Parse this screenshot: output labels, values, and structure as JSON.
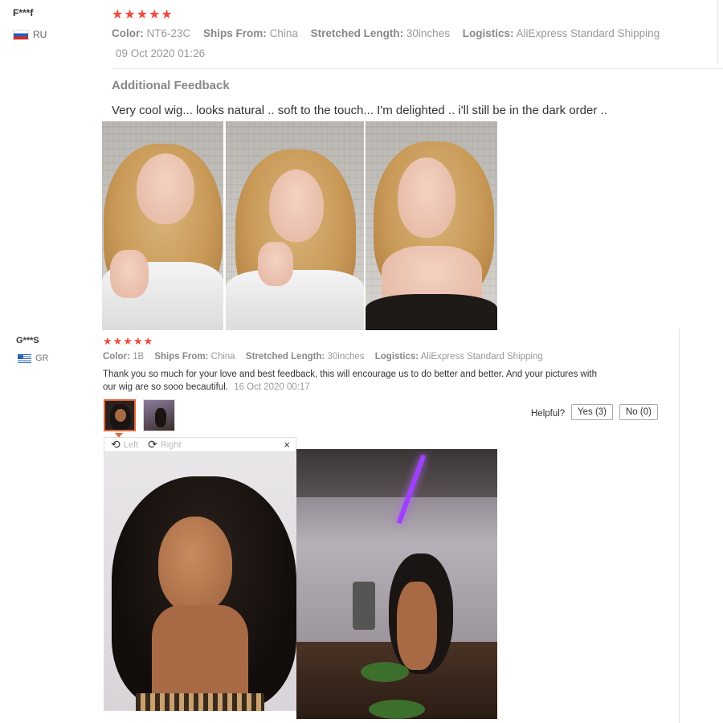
{
  "review1": {
    "user": "F***f",
    "country": "RU",
    "stars": "★★★★★",
    "color_label": "Color:",
    "color_value": "NT6-23C",
    "ships_label": "Ships From:",
    "ships_value": "China",
    "length_label": "Stretched Length:",
    "length_value": "30inches",
    "logistics_label": "Logistics:",
    "logistics_value": "AliExpress Standard Shipping",
    "date": "09 Oct 2020 01:26",
    "additional_title": "Additional Feedback",
    "text": "Very cool wig... looks natural .. soft to the touch... I'm delighted .. i'll still be in the dark order .."
  },
  "review2": {
    "user": "G***S",
    "country": "GR",
    "stars": "★★★★★",
    "color_label": "Color:",
    "color_value": "1B",
    "ships_label": "Ships From:",
    "ships_value": "China",
    "length_label": "Stretched Length:",
    "length_value": "30inches",
    "logistics_label": "Logistics:",
    "logistics_value": "AliExpress Standard Shipping",
    "text": "Thank you so much for your love and best feedback, this will encourage us to do better and better. And your pictures with our wig are so sooo becautiful.",
    "date": "16 Oct 2020 00:17",
    "helpful_label": "Helpful?",
    "yes_label": "Yes (3)",
    "no_label": "No (0)",
    "viewer": {
      "rotate_left": "Left",
      "rotate_right": "Right",
      "close": "×"
    }
  },
  "icons": {
    "star": "star-icon",
    "rotate_left": "rotate-left-icon",
    "rotate_right": "rotate-right-icon",
    "close": "close-icon"
  },
  "colors": {
    "star": "#f04b3e",
    "active_thumb_border": "#e4673c",
    "label_gray": "#888888"
  }
}
